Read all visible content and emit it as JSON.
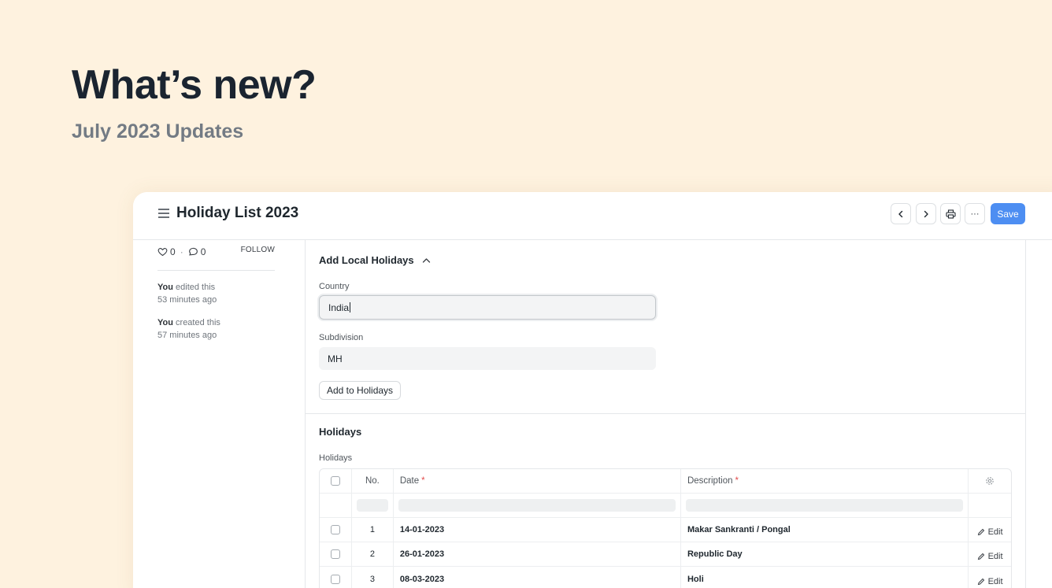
{
  "promo": {
    "title": "What’s new?",
    "subtitle": "July 2023 Updates"
  },
  "toolbar": {
    "title": "Holiday List 2023",
    "save_label": "Save",
    "more_label": "···"
  },
  "sidebar": {
    "likes_count": "0",
    "separator": "·",
    "comments_count": "0",
    "follow_label": "FOLLOW",
    "activity": [
      {
        "actor": "You",
        "action": " edited this",
        "time": "53 minutes ago"
      },
      {
        "actor": "You",
        "action": " created this",
        "time": "57 minutes ago"
      }
    ]
  },
  "local_holidays": {
    "title": "Add Local Holidays",
    "country_label": "Country",
    "country_value": "India",
    "subdivision_label": "Subdivision",
    "subdivision_value": "MH",
    "add_button": "Add to Holidays"
  },
  "holidays": {
    "section_title": "Holidays",
    "table_label": "Holidays",
    "columns": {
      "no": "No.",
      "date": "Date",
      "description": "Description",
      "required_mark": "*"
    },
    "edit_label": "Edit",
    "rows": [
      {
        "no": "1",
        "date": "14-01-2023",
        "description": "Makar Sankranti / Pongal"
      },
      {
        "no": "2",
        "date": "26-01-2023",
        "description": "Republic Day"
      },
      {
        "no": "3",
        "date": "08-03-2023",
        "description": "Holi"
      }
    ]
  }
}
